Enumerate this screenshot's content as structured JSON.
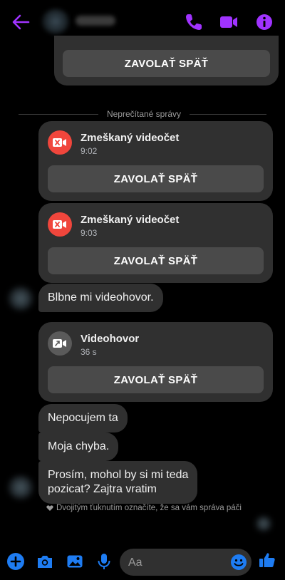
{
  "header": {
    "contact_name": "Martin",
    "icons": [
      "back-arrow-icon",
      "phone-icon",
      "video-camera-icon",
      "info-icon"
    ],
    "accent": "#a033ff"
  },
  "thread": {
    "top_card": {
      "button_label": "ZAVOLAŤ SPÄŤ"
    },
    "unread_divider": "Neprečítané správy",
    "missed_call_1": {
      "title": "Zmeškaný videočet",
      "time": "9:02",
      "button_label": "ZAVOLAŤ SPÄŤ",
      "icon": "missed-video-icon",
      "icon_color": "#f0463c"
    },
    "missed_call_2": {
      "title": "Zmeškaný videočet",
      "time": "9:03",
      "button_label": "ZAVOLAŤ SPÄŤ",
      "icon": "missed-video-icon",
      "icon_color": "#f0463c"
    },
    "message_1": "Blbne mi videohovor.",
    "video_call": {
      "title": "Videohovor",
      "duration": "36 s",
      "button_label": "ZAVOLAŤ SPÄŤ",
      "icon": "video-call-icon",
      "icon_color": "#5a5a5a"
    },
    "message_2": "Nepocujem ta",
    "message_3": "Moja chyba.",
    "message_4_line_1": "Prosím, mohol by si mi teda",
    "message_4_line_2": "pozicat? Zajtra vratim",
    "double_tap_hint": "Dvojitým ťuknutím označíte, že sa vám správa páči"
  },
  "composer": {
    "placeholder": "Aa",
    "icons": [
      "plus-icon",
      "camera-icon",
      "image-icon",
      "microphone-icon",
      "emoji-icon",
      "thumbs-up-icon"
    ],
    "accent": "#1e7cf2"
  }
}
